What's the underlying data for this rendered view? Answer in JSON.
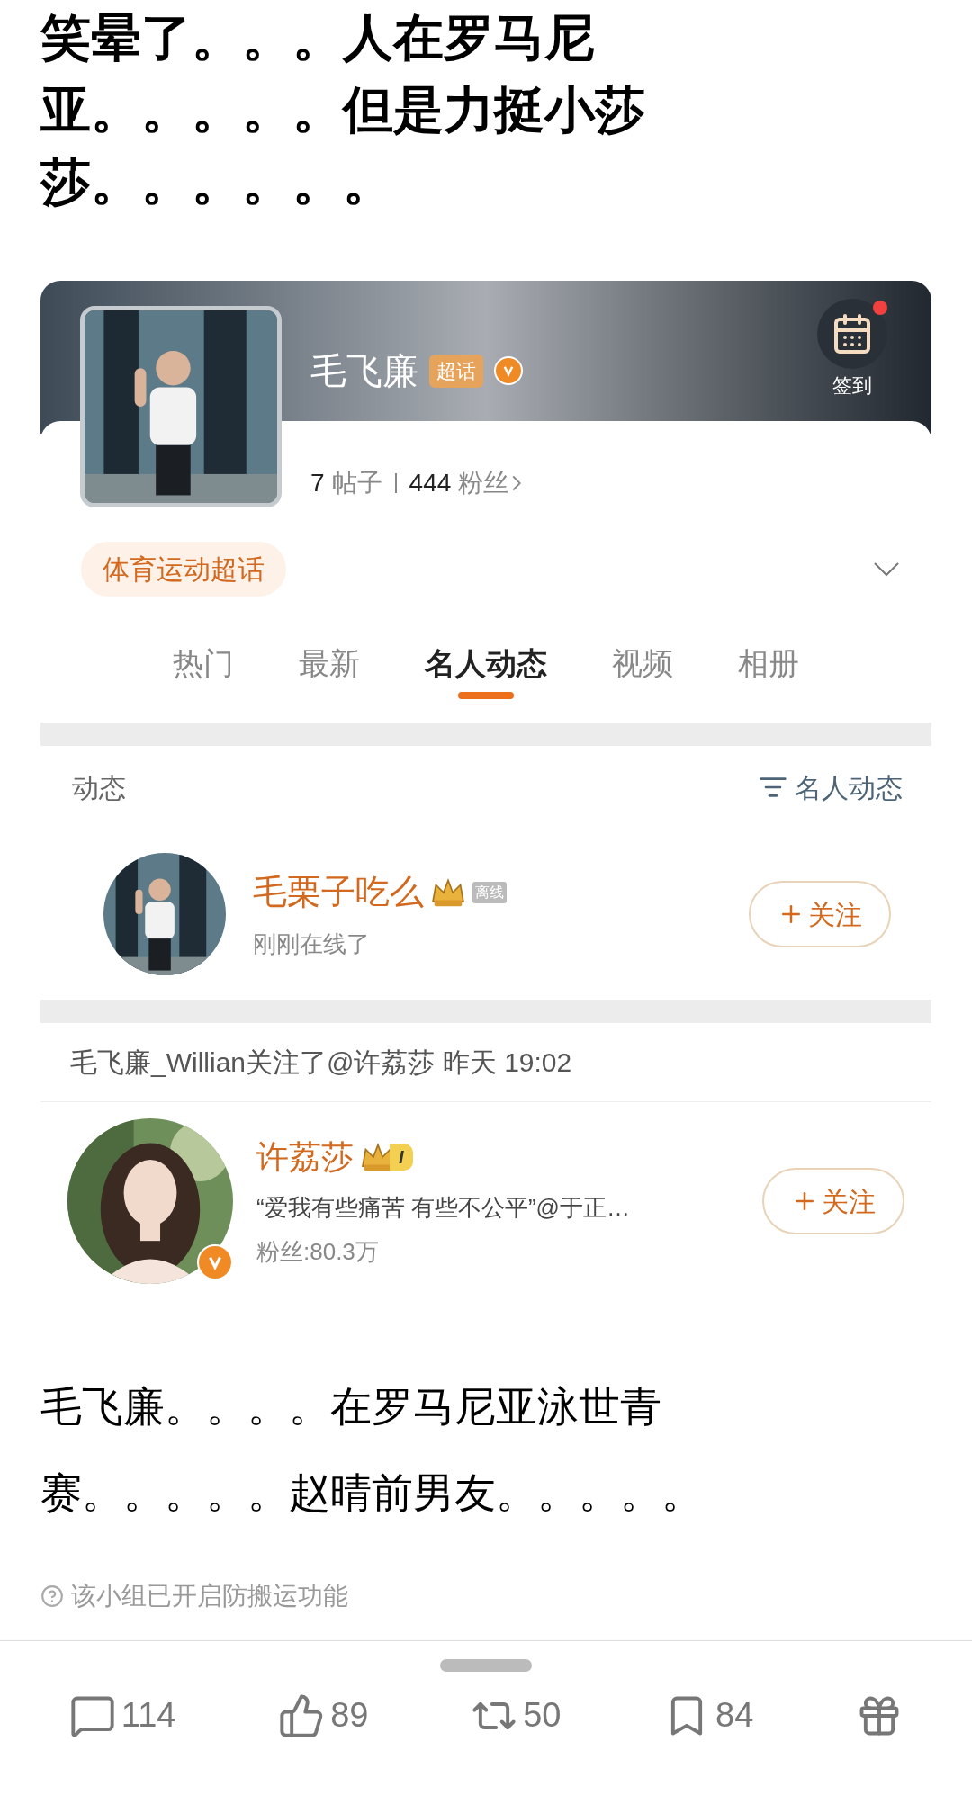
{
  "post": {
    "headline_lines": [
      "笑晕了。。。人在罗马尼",
      "亚。。。。。但是力挺小莎",
      "莎。。。。。。"
    ]
  },
  "topic_card": {
    "name": "毛飞廉",
    "badge": "超话",
    "verified": true,
    "checkin": {
      "label": "签到",
      "has_notification": true
    },
    "stats": [
      {
        "count": "7",
        "label": "帖子"
      },
      {
        "count": "444",
        "label": "粉丝"
      }
    ],
    "category": "体育运动超话",
    "tabs": [
      {
        "label": "热门",
        "selected": false
      },
      {
        "label": "最新",
        "selected": false
      },
      {
        "label": "名人动态",
        "selected": true
      },
      {
        "label": "视频",
        "selected": false
      },
      {
        "label": "相册",
        "selected": false
      }
    ],
    "feed": {
      "title": "动态",
      "filter": "名人动态",
      "online_user": {
        "name": "毛栗子吃么",
        "status_badge": "离线",
        "subtitle": "刚刚在线了",
        "follow": "关注"
      },
      "activity": "毛飞廉_Willian关注了@许荔莎 昨天 19:02",
      "followed_user": {
        "name": "许荔莎",
        "level": "I",
        "quote": "“爱我有些痛苦 有些不公平”@于正…",
        "fans": "粉丝:80.3万",
        "follow": "关注",
        "verified": true
      }
    }
  },
  "body_lines": [
    "毛飞廉。。。。在罗马尼亚泳世青",
    "赛。。。。。赵晴前男友。。。。。"
  ],
  "notice": "该小组已开启防搬运功能",
  "actions": [
    {
      "kind": "comment",
      "count": "114"
    },
    {
      "kind": "like",
      "count": "89"
    },
    {
      "kind": "repost",
      "count": "50"
    },
    {
      "kind": "bookmark",
      "count": "84"
    },
    {
      "kind": "gift"
    }
  ]
}
